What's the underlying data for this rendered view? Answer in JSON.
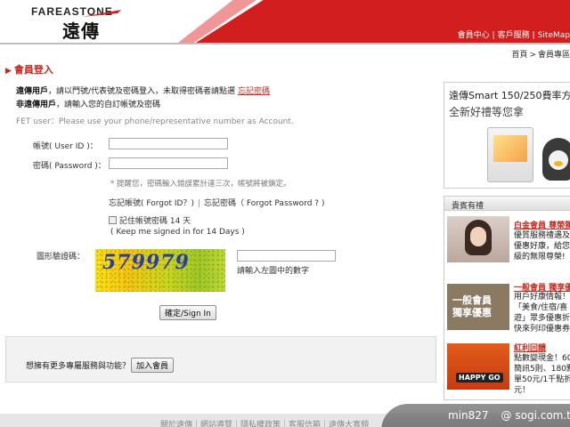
{
  "header": {
    "brand_en": "FAREASTONE",
    "brand_cn": "遠傳",
    "nav": [
      "會員中心",
      "客戶服務",
      "SiteMap"
    ]
  },
  "breadcrumb": [
    "首頁",
    "會員專區"
  ],
  "page_title": "會員登入",
  "intro": {
    "line1_bold": "遠傳用戶",
    "line1_text": "，請以門號/代表號及密碼登入，未取得密碼者請點選",
    "line1_link": "忘記密碼",
    "line2_bold": "非遠傳用戶",
    "line2_text": "，請輸入您的自訂帳號及密碼",
    "line3": "FET user：Please use your phone/representative number as Account."
  },
  "form": {
    "account_label": "帳號( User ID )：",
    "account_value": "",
    "password_label": "密碼( Password )：",
    "password_value": "",
    "warning": "* 提醒您，密碼輸入錯誤累計達三次，帳號將被鎖定。",
    "forgot_id": "忘記帳號( Forgot ID？)",
    "forgot_pw": "忘記密碼（ Forgot Password ? )",
    "remember_label": "記住帳號密碼 14 天",
    "remember_en": "( Keep me signed in for 14 Days )",
    "captcha_label": "圖形驗證碼：",
    "captcha_text": "579979",
    "captcha_value": "",
    "captcha_hint": "請輸入左圖中的數字",
    "submit": "確定/Sign In"
  },
  "join": {
    "text": "想擁有更多專屬服務與功能？",
    "button": "加入會員"
  },
  "promo": {
    "line1": "遠傳Smart 150/250費率方",
    "line2": "全新好禮等您拿"
  },
  "vip": {
    "title": "貴賓有禮",
    "items": [
      {
        "title": "白金會員 尊榮獨",
        "lines": [
          "優質服務禮遇及感",
          "優惠好康，給您",
          "級的無限尊榮!"
        ]
      },
      {
        "image_text": "一般會員\n獨享優惠",
        "title": "一般會員 獨享優",
        "lines": [
          "用戶好康情報！多",
          "「美食/住宿/喜",
          "遊」眾多優惠折",
          "快來列印優惠券"
        ]
      },
      {
        "image_text": "HAPPY GO",
        "title": "紅利回饋",
        "lines": [
          "點數變現金！60",
          "簡訊5則、180點",
          "單50元/1千點折",
          "元！"
        ]
      }
    ]
  },
  "footer": {
    "links": "關於遠傳｜網站導覽｜隱私權政策｜客服信箱｜遠傳大寬頻"
  },
  "watermark": {
    "user": "min827",
    "site": "@ sogi.com.tw"
  },
  "colors": {
    "brand_red": "#d21e1e",
    "link_red": "#c8281e"
  }
}
